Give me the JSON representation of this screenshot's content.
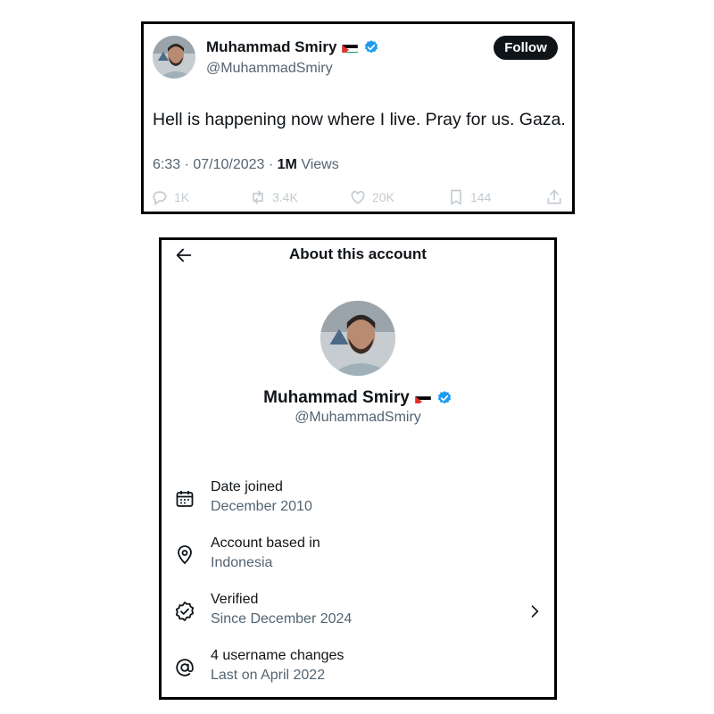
{
  "tweet": {
    "display_name": "Muhammad Smiry",
    "flag_icon": "palestine-flag-icon",
    "verified_icon": "verified-badge-icon",
    "handle": "@MuhammadSmiry",
    "follow_label": "Follow",
    "text": "Hell is happening now where I live. Pray for us. Gaza.",
    "timestamp": "6:33 · 07/10/2023 · ",
    "views_count": "1M",
    "views_label": " Views",
    "actions": [
      {
        "icon": "reply-icon",
        "count": "1K"
      },
      {
        "icon": "retweet-icon",
        "count": "3.4K"
      },
      {
        "icon": "like-icon",
        "count": "20K"
      },
      {
        "icon": "bookmark-icon",
        "count": "144"
      },
      {
        "icon": "share-icon",
        "count": ""
      }
    ]
  },
  "about": {
    "title": "About this account",
    "back_icon": "back-arrow-icon",
    "display_name": "Muhammad Smiry",
    "handle": "@MuhammadSmiry",
    "items": [
      {
        "icon": "calendar-icon",
        "label": "Date joined",
        "value": "December 2010"
      },
      {
        "icon": "location-pin-icon",
        "label": "Account based in",
        "value": "Indonesia"
      },
      {
        "icon": "verified-outline-icon",
        "label": "Verified",
        "value": "Since December 2024"
      },
      {
        "icon": "at-sign-icon",
        "label": "4 username changes",
        "value": "Last on April 2022"
      }
    ]
  },
  "colors": {
    "text_primary": "#0f1419",
    "text_secondary": "#536471",
    "verified_blue": "#1d9bf0",
    "action_icons": "#c3cbd1"
  }
}
